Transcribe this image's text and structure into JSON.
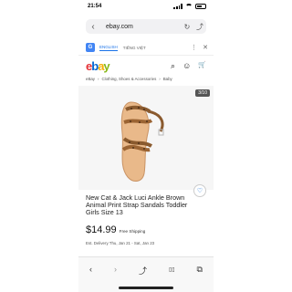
{
  "status_bar": {
    "time": "21:54"
  },
  "browser": {
    "url": "ebay.com",
    "back_icon": "‹",
    "reload_icon": "↻",
    "share_icon": "⤴"
  },
  "translate_bar": {
    "lang_english": "ENGLISH",
    "lang_vietnamese": "TIẾNG VIỆT",
    "more_icon": "⋮",
    "close_icon": "✕"
  },
  "header": {
    "logo": [
      "e",
      "b",
      "a",
      "y"
    ],
    "search_icon": "⌕",
    "profile_icon": "☺",
    "cart_icon": "🛒"
  },
  "breadcrumb": [
    "eBay",
    "Clothing, Shoes & Accessories",
    "Baby"
  ],
  "image_counter": "3/10",
  "listing": {
    "title": "New Cat & Jack Luci Ankle Brown Animal Print Strap Sandals Toddler Girls Size 13",
    "price": "$14.99",
    "shipping": "Free Shipping",
    "delivery": "Est. Delivery Thu, Jan 21 - Sat, Jan 23"
  },
  "toolbar": {
    "back": "‹",
    "forward": "›",
    "share": "⤴",
    "bookmarks": "▯▯",
    "tabs": "⧉"
  },
  "colors": {
    "ebay_red": "#e53238",
    "ebay_blue": "#0064d2",
    "ebay_yellow": "#f5af02",
    "ebay_green": "#86b817"
  }
}
